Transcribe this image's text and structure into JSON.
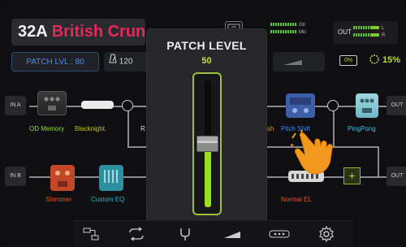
{
  "header": {
    "preset_number": "32A",
    "preset_name": "British Crunch",
    "input_meters": [
      {
        "label": "Gtr"
      },
      {
        "label": "Mic"
      }
    ],
    "output": {
      "label": "OUT",
      "channels": [
        {
          "label": "L"
        },
        {
          "label": "R"
        }
      ]
    }
  },
  "toolbar": {
    "patch_level_label": "PATCH LVL : 80",
    "tempo": "120",
    "battery_icon_text": "0%",
    "percent": "15%"
  },
  "chain": {
    "input_a": "IN A",
    "input_b": "IN B",
    "output_a": "OUT",
    "output_b": "OUT",
    "row_a": [
      {
        "label": "OD Memory",
        "color": "#8de12b"
      },
      {
        "label": "Blacknight.",
        "color": "#c4c02e"
      },
      {
        "label": "R",
        "color": "#ddd"
      },
      {
        "label": "sh",
        "color": "#d89a30"
      },
      {
        "label": "Pitch Shift",
        "color": "#4c83e0"
      },
      {
        "label": "PingPong",
        "color": "#3fc0d4"
      }
    ],
    "row_b": [
      {
        "label": "Shimmer",
        "color": "#e0582d"
      },
      {
        "label": "Custom EQ",
        "color": "#39b6c8"
      },
      {
        "label": "Normal EL",
        "color": "#e0582d"
      }
    ]
  },
  "overlay": {
    "title": "PATCH LEVEL",
    "value": "50",
    "level_fraction": 0.5
  },
  "bottom_bar": {
    "icons": [
      "routing-icon",
      "loop-icon",
      "tuner-icon",
      "expression-pedal-icon",
      "footswitch-icon",
      "settings-icon"
    ]
  },
  "colors": {
    "accent_green": "#9be01a",
    "preset_name": "#e6285a",
    "patch_lvl_blue": "#4e90e8",
    "hand": "#f39a1e"
  }
}
